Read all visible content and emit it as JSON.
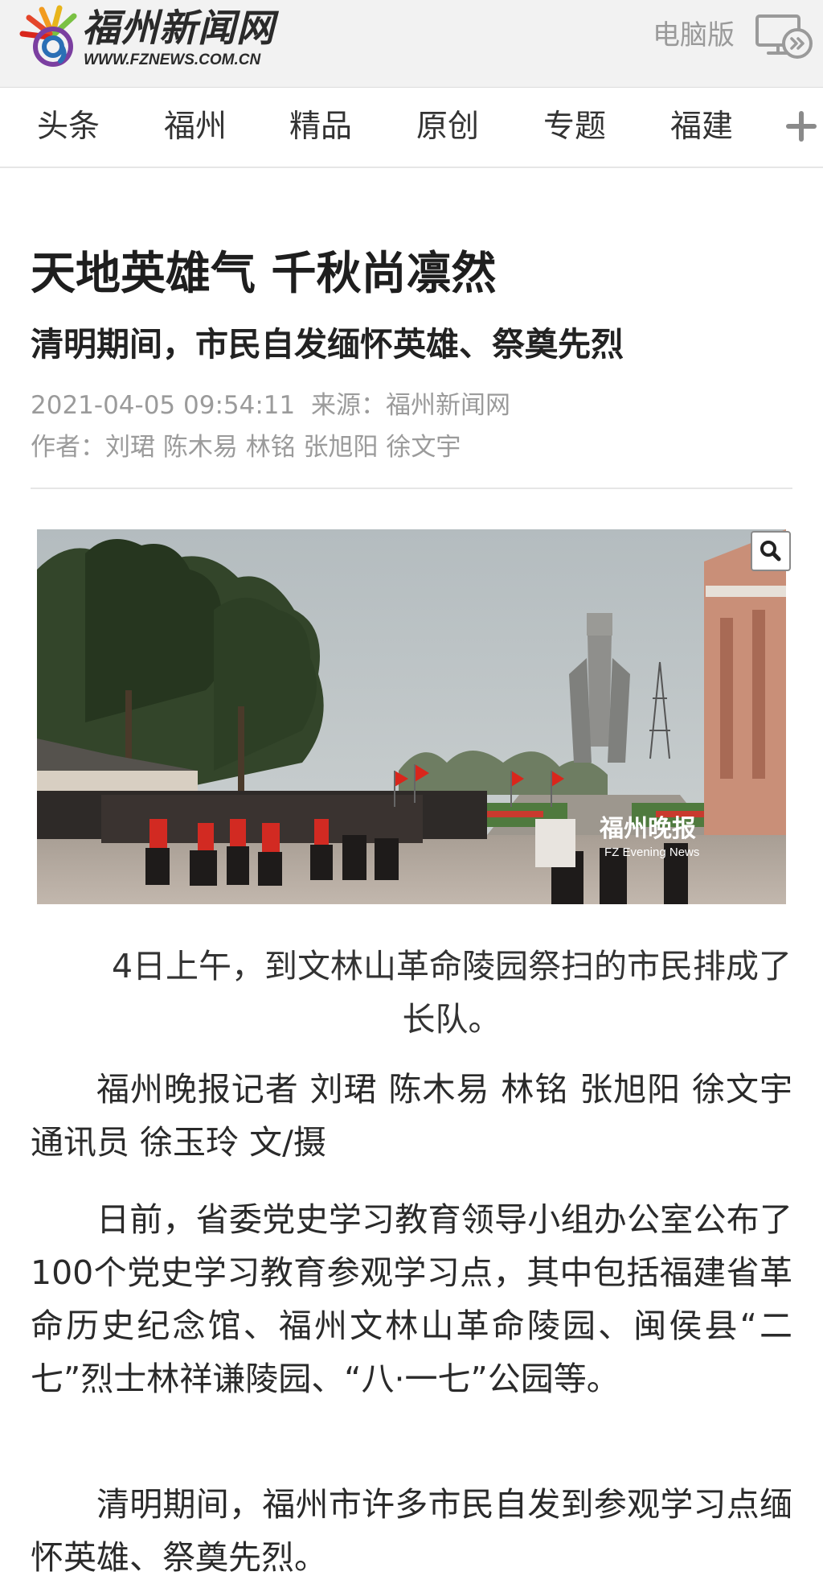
{
  "header": {
    "logo_name": "福州新闻网",
    "logo_url": "WWW.FZNEWS.COM.CN",
    "desktop_label": "电脑版"
  },
  "nav": {
    "tabs": [
      {
        "label": "头条"
      },
      {
        "label": "福州"
      },
      {
        "label": "精品"
      },
      {
        "label": "原创"
      },
      {
        "label": "专题"
      },
      {
        "label": "福建"
      }
    ]
  },
  "article": {
    "title": "天地英雄气 千秋尚凛然",
    "subtitle": "清明期间，市民自发缅怀英雄、祭奠先烈",
    "datetime": "2021-04-05 09:54:11",
    "source_label": "来源：",
    "source": "福州新闻网",
    "author_label": "作者：",
    "authors": "刘珺 陈木易 林铭 张旭阳 徐文宇",
    "photo": {
      "watermark_cn": "福州晚报",
      "watermark_en": "FZ Evening News",
      "caption": "4日上午，到文林山革命陵园祭扫的市民排成了长队。"
    },
    "paragraphs": [
      "福州晚报记者 刘珺 陈木易 林铭 张旭阳 徐文宇 通讯员 徐玉玲 文/摄",
      "日前，省委党史学习教育领导小组办公室公布了100个党史学习教育参观学习点，其中包括福建省革命历史纪念馆、福州文林山革命陵园、闽侯县“二七”烈士林祥谦陵园、“八·一七”公园等。",
      "清明期间，福州市许多市民自发到参观学习点缅怀英雄、祭奠先烈。"
    ]
  },
  "colors": {
    "header_bg": "#f2f2f2",
    "logo_orange": "#f29b1f",
    "logo_blue": "#2a6fb5",
    "logo_purple": "#7b3fa0",
    "muted_text": "#9b9b9b",
    "flag_red": "#d9261c"
  },
  "icons": [
    "fznews-logo-icon",
    "desktop-version-icon",
    "plus-icon",
    "search-icon"
  ]
}
